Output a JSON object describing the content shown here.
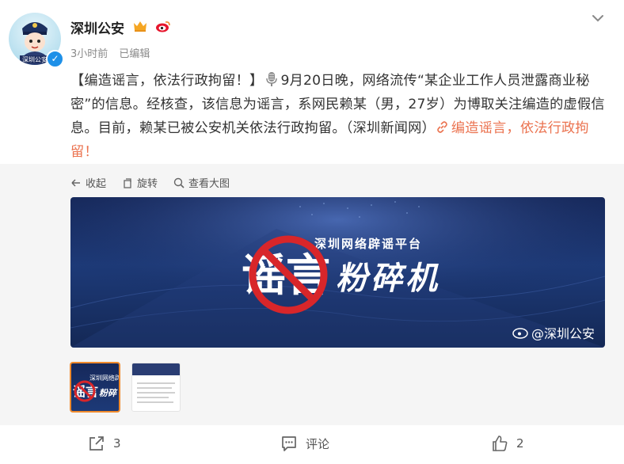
{
  "post": {
    "author": "深圳公安",
    "time": "3小时前",
    "edited": "已编辑",
    "text_part1": "【编造谣言，依法行政拘留！】",
    "text_part2": "9月20日晚，网络流传“某企业工作人员泄露商业秘密”的信息。经核查，该信息为谣言，系网民赖某（男，27岁）为博取关注编造的虚假信息。目前，赖某已被公安机关依法行政拘留。（深圳新闻网）",
    "link_text": "编造谣言，依法行政拘留！",
    "avatar_text": "深圳公安"
  },
  "media": {
    "toolbar": {
      "collapse": "收起",
      "rotate": "旋转",
      "view_large": "查看大图"
    },
    "image": {
      "platform": "深圳网络辟谣平台",
      "rumor": "谣言",
      "crusher": "粉碎机",
      "watermark": "@深圳公安"
    },
    "thumb1": {
      "rumor": "谣言",
      "crusher": "粉碎",
      "platform": "深圳网络辟谣"
    }
  },
  "actions": {
    "share_count": "3",
    "comment_label": "评论",
    "like_count": "2"
  },
  "colors": {
    "link": "#eb7350",
    "accent": "#f08a2c",
    "verified": "#1e90e8"
  }
}
